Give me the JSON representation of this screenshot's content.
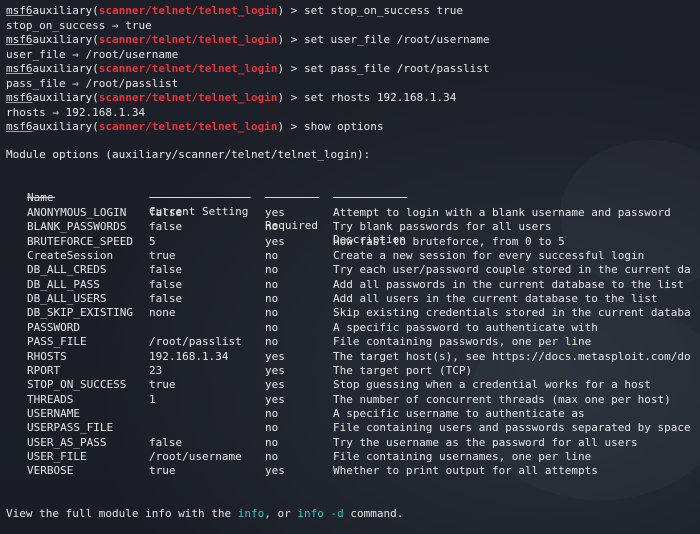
{
  "prompt": {
    "msf": "msf6",
    "module_prefix": "auxiliary(",
    "module_path": "scanner/telnet/telnet_login",
    "module_suffix": ") > "
  },
  "history": [
    {
      "command": "set stop_on_success true",
      "output": "stop_on_success ⇒ true"
    },
    {
      "command": "set user_file /root/username",
      "output": "user_file ⇒ /root/username"
    },
    {
      "command": "set pass_file /root/passlist",
      "output": "pass_file ⇒ /root/passlist"
    },
    {
      "command": "set rhosts 192.168.1.34",
      "output": "rhosts ⇒ 192.168.1.34"
    },
    {
      "command": "show options",
      "output": ""
    }
  ],
  "options_title": "Module options (auxiliary/scanner/telnet/telnet_login):",
  "table": {
    "headers": {
      "name": "Name",
      "setting": "Current Setting",
      "required": "Required",
      "description": "Description"
    },
    "rows": [
      {
        "name": "ANONYMOUS_LOGIN",
        "setting": "false",
        "required": "yes",
        "description": "Attempt to login with a blank username and password"
      },
      {
        "name": "BLANK_PASSWORDS",
        "setting": "false",
        "required": "no",
        "description": "Try blank passwords for all users"
      },
      {
        "name": "BRUTEFORCE_SPEED",
        "setting": "5",
        "required": "yes",
        "description": "How fast to bruteforce, from 0 to 5"
      },
      {
        "name": "CreateSession",
        "setting": "true",
        "required": "no",
        "description": "Create a new session for every successful login"
      },
      {
        "name": "DB_ALL_CREDS",
        "setting": "false",
        "required": "no",
        "description": "Try each user/password couple stored in the current da"
      },
      {
        "name": "DB_ALL_PASS",
        "setting": "false",
        "required": "no",
        "description": "Add all passwords in the current database to the list"
      },
      {
        "name": "DB_ALL_USERS",
        "setting": "false",
        "required": "no",
        "description": "Add all users in the current database to the list"
      },
      {
        "name": "DB_SKIP_EXISTING",
        "setting": "none",
        "required": "no",
        "description": "Skip existing credentials stored in the current databa"
      },
      {
        "name": "PASSWORD",
        "setting": "",
        "required": "no",
        "description": "A specific password to authenticate with"
      },
      {
        "name": "PASS_FILE",
        "setting": "/root/passlist",
        "required": "no",
        "description": "File containing passwords, one per line"
      },
      {
        "name": "RHOSTS",
        "setting": "192.168.1.34",
        "required": "yes",
        "description": "The target host(s), see https://docs.metasploit.com/do"
      },
      {
        "name": "RPORT",
        "setting": "23",
        "required": "yes",
        "description": "The target port (TCP)"
      },
      {
        "name": "STOP_ON_SUCCESS",
        "setting": "true",
        "required": "yes",
        "description": "Stop guessing when a credential works for a host"
      },
      {
        "name": "THREADS",
        "setting": "1",
        "required": "yes",
        "description": "The number of concurrent threads (max one per host)"
      },
      {
        "name": "USERNAME",
        "setting": "",
        "required": "no",
        "description": "A specific username to authenticate as"
      },
      {
        "name": "USERPASS_FILE",
        "setting": "",
        "required": "no",
        "description": "File containing users and passwords separated by space"
      },
      {
        "name": "USER_AS_PASS",
        "setting": "false",
        "required": "no",
        "description": "Try the username as the password for all users"
      },
      {
        "name": "USER_FILE",
        "setting": "/root/username",
        "required": "no",
        "description": "File containing usernames, one per line"
      },
      {
        "name": "VERBOSE",
        "setting": "true",
        "required": "yes",
        "description": "Whether to print output for all attempts"
      }
    ]
  },
  "footer": {
    "pre": "View the full module info with the ",
    "info": "info",
    "mid": ", or ",
    "info_d": "info -d",
    "post": " command."
  },
  "colors": {
    "background": "#1b1e26",
    "text": "#e6e6e6",
    "module_red": "#e8323c",
    "command_cyan": "#2ec4c4"
  }
}
